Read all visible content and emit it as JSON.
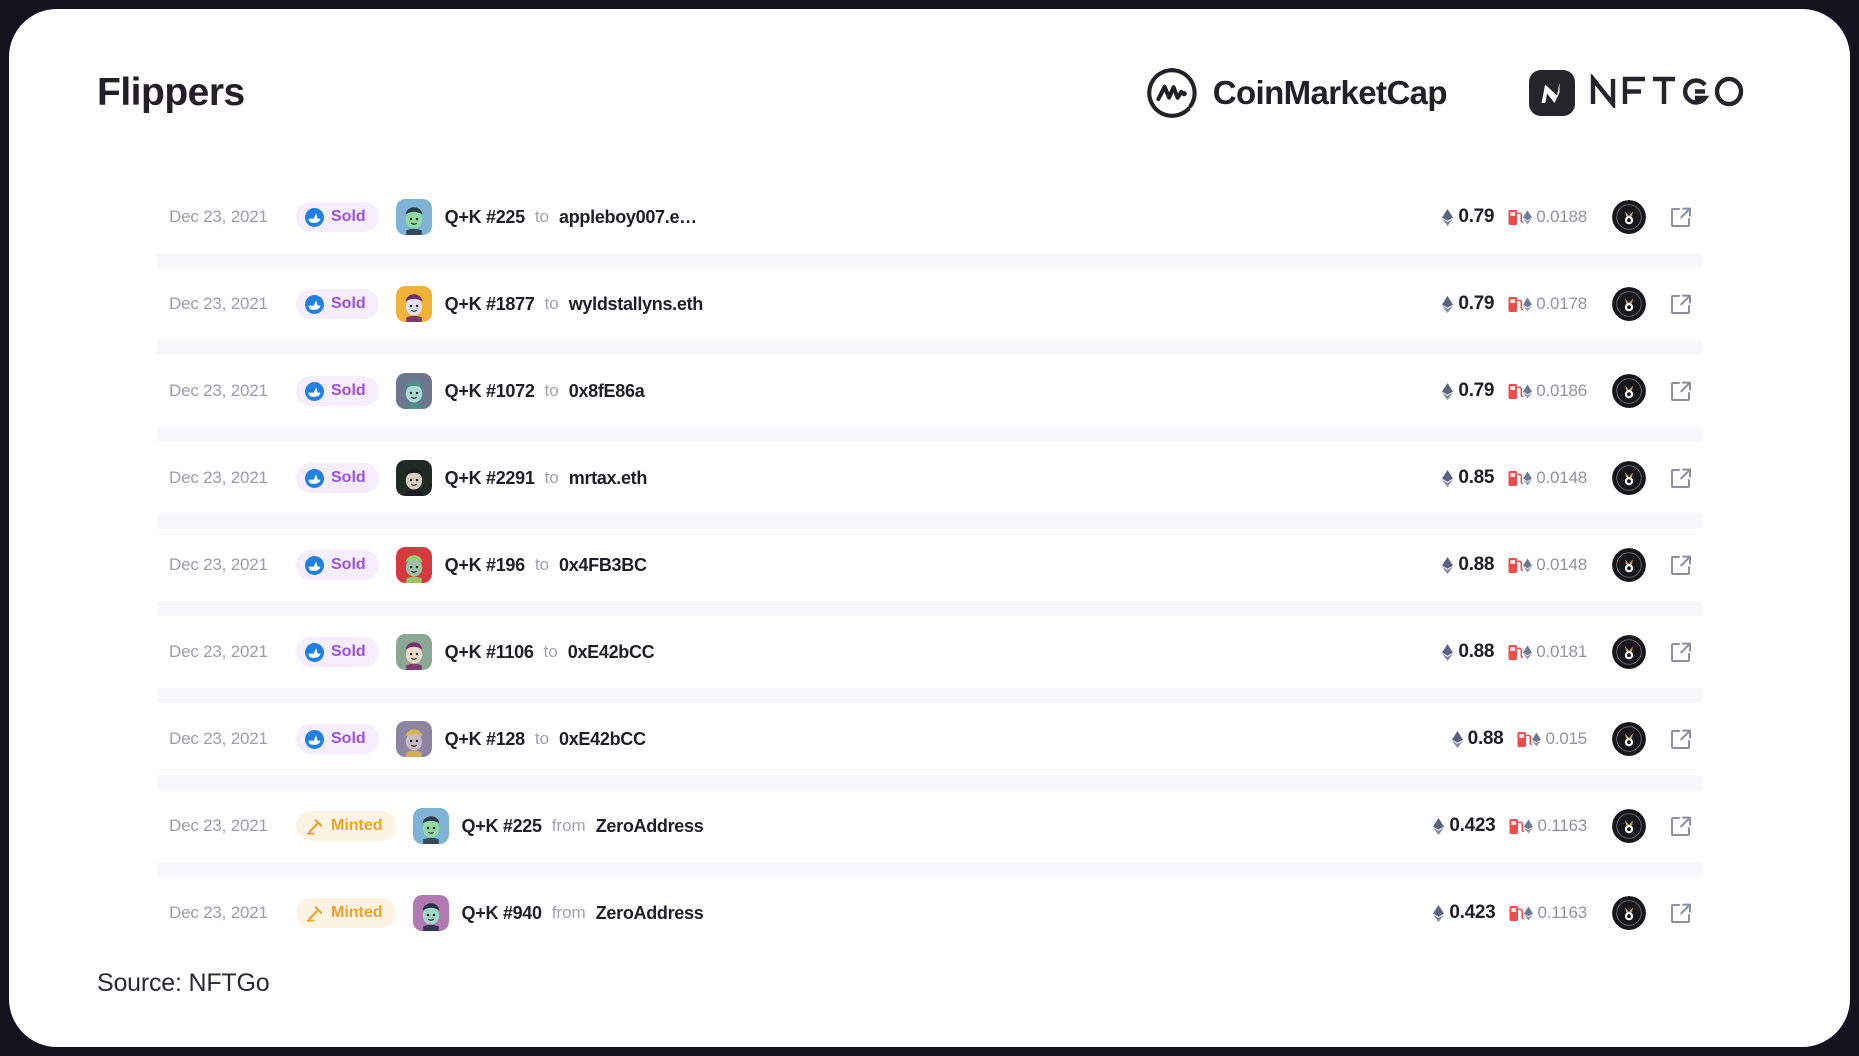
{
  "window": {
    "background_color": "#14121f",
    "card_color": "#ffffff"
  },
  "header": {
    "title": "Flippers",
    "brands": [
      {
        "name": "CoinMarketCap",
        "icon": "coinmarketcap-logo-icon"
      },
      {
        "name": "NFTGO",
        "icon": "nftgo-logo-icon"
      }
    ]
  },
  "colors": {
    "sold_badge_bg": "#f6eefc",
    "sold_badge_text": "#9b51e0",
    "minted_badge_bg": "#fdf3e2",
    "minted_badge_text": "#f0a02e",
    "row_separator": "#f7f8f9",
    "muted_text": "#9a9dab",
    "primary_text": "#1f1d26",
    "gas_icon": "#ef4b4b"
  },
  "table": {
    "columns": [
      "date",
      "event",
      "asset",
      "preposition",
      "counterparty",
      "price",
      "gas",
      "collection",
      "link"
    ],
    "rows": [
      {
        "date": "Dec 23, 2021",
        "event": "Sold",
        "event_type": "sold",
        "event_icon": "opensea-icon",
        "asset": "Q+K #225",
        "preposition": "to",
        "counterparty": "appleboy007.e…",
        "price": "0.79",
        "price_currency": "ETH",
        "gas": "0.0188",
        "gas_currency": "ETH",
        "thumb": {
          "bg": "#7fb3d5",
          "skin": "#8fdca0",
          "hair": "#2f3b4a"
        },
        "collection_icon": "queens-kings-avatar",
        "link_icon": "external-link-icon"
      },
      {
        "date": "Dec 23, 2021",
        "event": "Sold",
        "event_type": "sold",
        "event_icon": "opensea-icon",
        "asset": "Q+K #1877",
        "preposition": "to",
        "counterparty": "wyldstallyns.eth",
        "price": "0.79",
        "price_currency": "ETH",
        "gas": "0.0178",
        "gas_currency": "ETH",
        "thumb": {
          "bg": "#f2b233",
          "skin": "#e4e0ef",
          "hair": "#6b2f6b"
        },
        "collection_icon": "queens-kings-avatar",
        "link_icon": "external-link-icon"
      },
      {
        "date": "Dec 23, 2021",
        "event": "Sold",
        "event_type": "sold",
        "event_icon": "opensea-icon",
        "asset": "Q+K #1072",
        "preposition": "to",
        "counterparty": "0x8fE86a",
        "price": "0.79",
        "price_currency": "ETH",
        "gas": "0.0186",
        "gas_currency": "ETH",
        "thumb": {
          "bg": "#6e7790",
          "skin": "#a8ddd4",
          "hair": "#4b8f86"
        },
        "collection_icon": "queens-kings-avatar",
        "link_icon": "external-link-icon"
      },
      {
        "date": "Dec 23, 2021",
        "event": "Sold",
        "event_type": "sold",
        "event_icon": "opensea-icon",
        "asset": "Q+K #2291",
        "preposition": "to",
        "counterparty": "mrtax.eth",
        "price": "0.85",
        "price_currency": "ETH",
        "gas": "0.0148",
        "gas_currency": "ETH",
        "thumb": {
          "bg": "#1e2a22",
          "skin": "#d8cfc2",
          "hair": "#1b1b22"
        },
        "collection_icon": "queens-kings-avatar",
        "link_icon": "external-link-icon"
      },
      {
        "date": "Dec 23, 2021",
        "event": "Sold",
        "event_type": "sold",
        "event_icon": "opensea-icon",
        "asset": "Q+K #196",
        "preposition": "to",
        "counterparty": "0x4FB3BC",
        "price": "0.88",
        "price_currency": "ETH",
        "gas": "0.0148",
        "gas_currency": "ETH",
        "thumb": {
          "bg": "#d8393f",
          "skin": "#9fc0a8",
          "hair": "#8fd46a"
        },
        "collection_icon": "queens-kings-avatar",
        "link_icon": "external-link-icon"
      },
      {
        "date": "Dec 23, 2021",
        "event": "Sold",
        "event_type": "sold",
        "event_icon": "opensea-icon",
        "asset": "Q+K #1106",
        "preposition": "to",
        "counterparty": "0xE42bCC",
        "price": "0.88",
        "price_currency": "ETH",
        "gas": "0.0181",
        "gas_currency": "ETH",
        "thumb": {
          "bg": "#8aa894",
          "skin": "#ecd9c6",
          "hair": "#7a2f6e"
        },
        "collection_icon": "queens-kings-avatar",
        "link_icon": "external-link-icon"
      },
      {
        "date": "Dec 23, 2021",
        "event": "Sold",
        "event_type": "sold",
        "event_icon": "opensea-icon",
        "asset": "Q+K #128",
        "preposition": "to",
        "counterparty": "0xE42bCC",
        "price": "0.88",
        "price_currency": "ETH",
        "gas": "0.015",
        "gas_currency": "ETH",
        "thumb": {
          "bg": "#8c84a0",
          "skin": "#c9b9c4",
          "hair": "#d8b44a"
        },
        "collection_icon": "queens-kings-avatar",
        "link_icon": "external-link-icon"
      },
      {
        "date": "Dec 23, 2021",
        "event": "Minted",
        "event_type": "minted",
        "event_icon": "hammer-icon",
        "asset": "Q+K #225",
        "preposition": "from",
        "counterparty": "ZeroAddress",
        "price": "0.423",
        "price_currency": "ETH",
        "gas": "0.1163",
        "gas_currency": "ETH",
        "thumb": {
          "bg": "#7fb3d5",
          "skin": "#8fdca0",
          "hair": "#2f3b4a"
        },
        "collection_icon": "queens-kings-avatar",
        "link_icon": "external-link-icon"
      },
      {
        "date": "Dec 23, 2021",
        "event": "Minted",
        "event_type": "minted",
        "event_icon": "hammer-icon",
        "asset": "Q+K #940",
        "preposition": "from",
        "counterparty": "ZeroAddress",
        "price": "0.423",
        "price_currency": "ETH",
        "gas": "0.1163",
        "gas_currency": "ETH",
        "thumb": {
          "bg": "#b07ab0",
          "skin": "#9fd9c8",
          "hair": "#2a2f4a"
        },
        "collection_icon": "queens-kings-avatar",
        "link_icon": "external-link-icon"
      }
    ]
  },
  "footer": {
    "source": "Source: NFTGo"
  }
}
